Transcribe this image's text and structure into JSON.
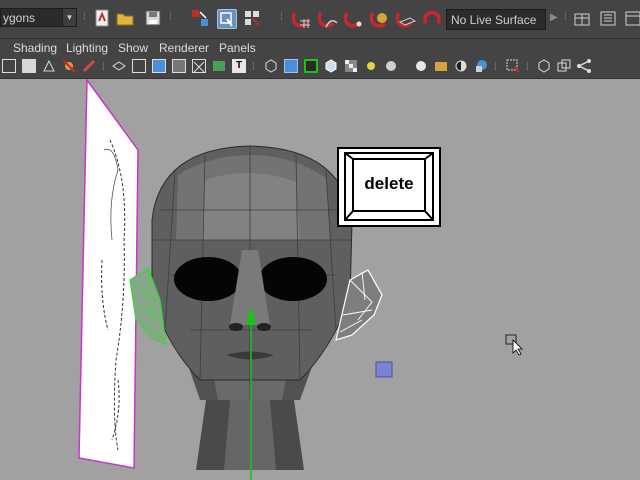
{
  "toolbar": {
    "mode_selector": {
      "value": "ygons"
    },
    "live_surface": "No Live Surface"
  },
  "menu": {
    "items": [
      "Shading",
      "Lighting",
      "Show",
      "Renderer",
      "Panels"
    ]
  },
  "overlay": {
    "key_label": "delete"
  },
  "colors": {
    "toolbar_bg": "#444444",
    "viewport_bg": "#a1a1a1",
    "magnet_red": "#c8282d",
    "manipulator_green": "#19c419",
    "reference_plane_border": "#cc33cc",
    "selection_square": "#7c82d6"
  },
  "icons": [
    "new-scene-icon",
    "open-scene-icon",
    "save-scene-icon",
    "select-tool-icon",
    "lasso-icon",
    "paint-select-icon",
    "snap-grid-icon",
    "snap-curve-icon",
    "snap-point-icon",
    "snap-plane-icon",
    "snap-surface-icon",
    "make-live-icon",
    "panel-layout-icon",
    "attribute-editor-icon",
    "move-cursor-icon"
  ]
}
